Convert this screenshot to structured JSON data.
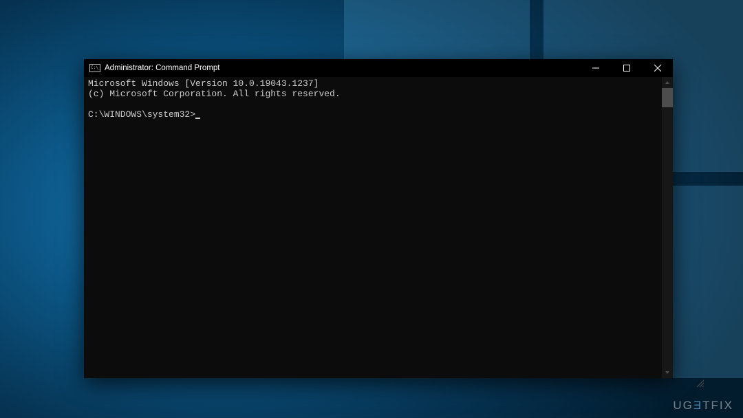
{
  "window": {
    "title": "Administrator: Command Prompt",
    "icon_name": "cmd-icon"
  },
  "terminal": {
    "line1": "Microsoft Windows [Version 10.0.19043.1237]",
    "line2": "(c) Microsoft Corporation. All rights reserved.",
    "blank": "",
    "prompt": "C:\\WINDOWS\\system32>"
  },
  "watermark": {
    "pre": "UG",
    "e": "Ǝ",
    "post": "TFIX"
  }
}
